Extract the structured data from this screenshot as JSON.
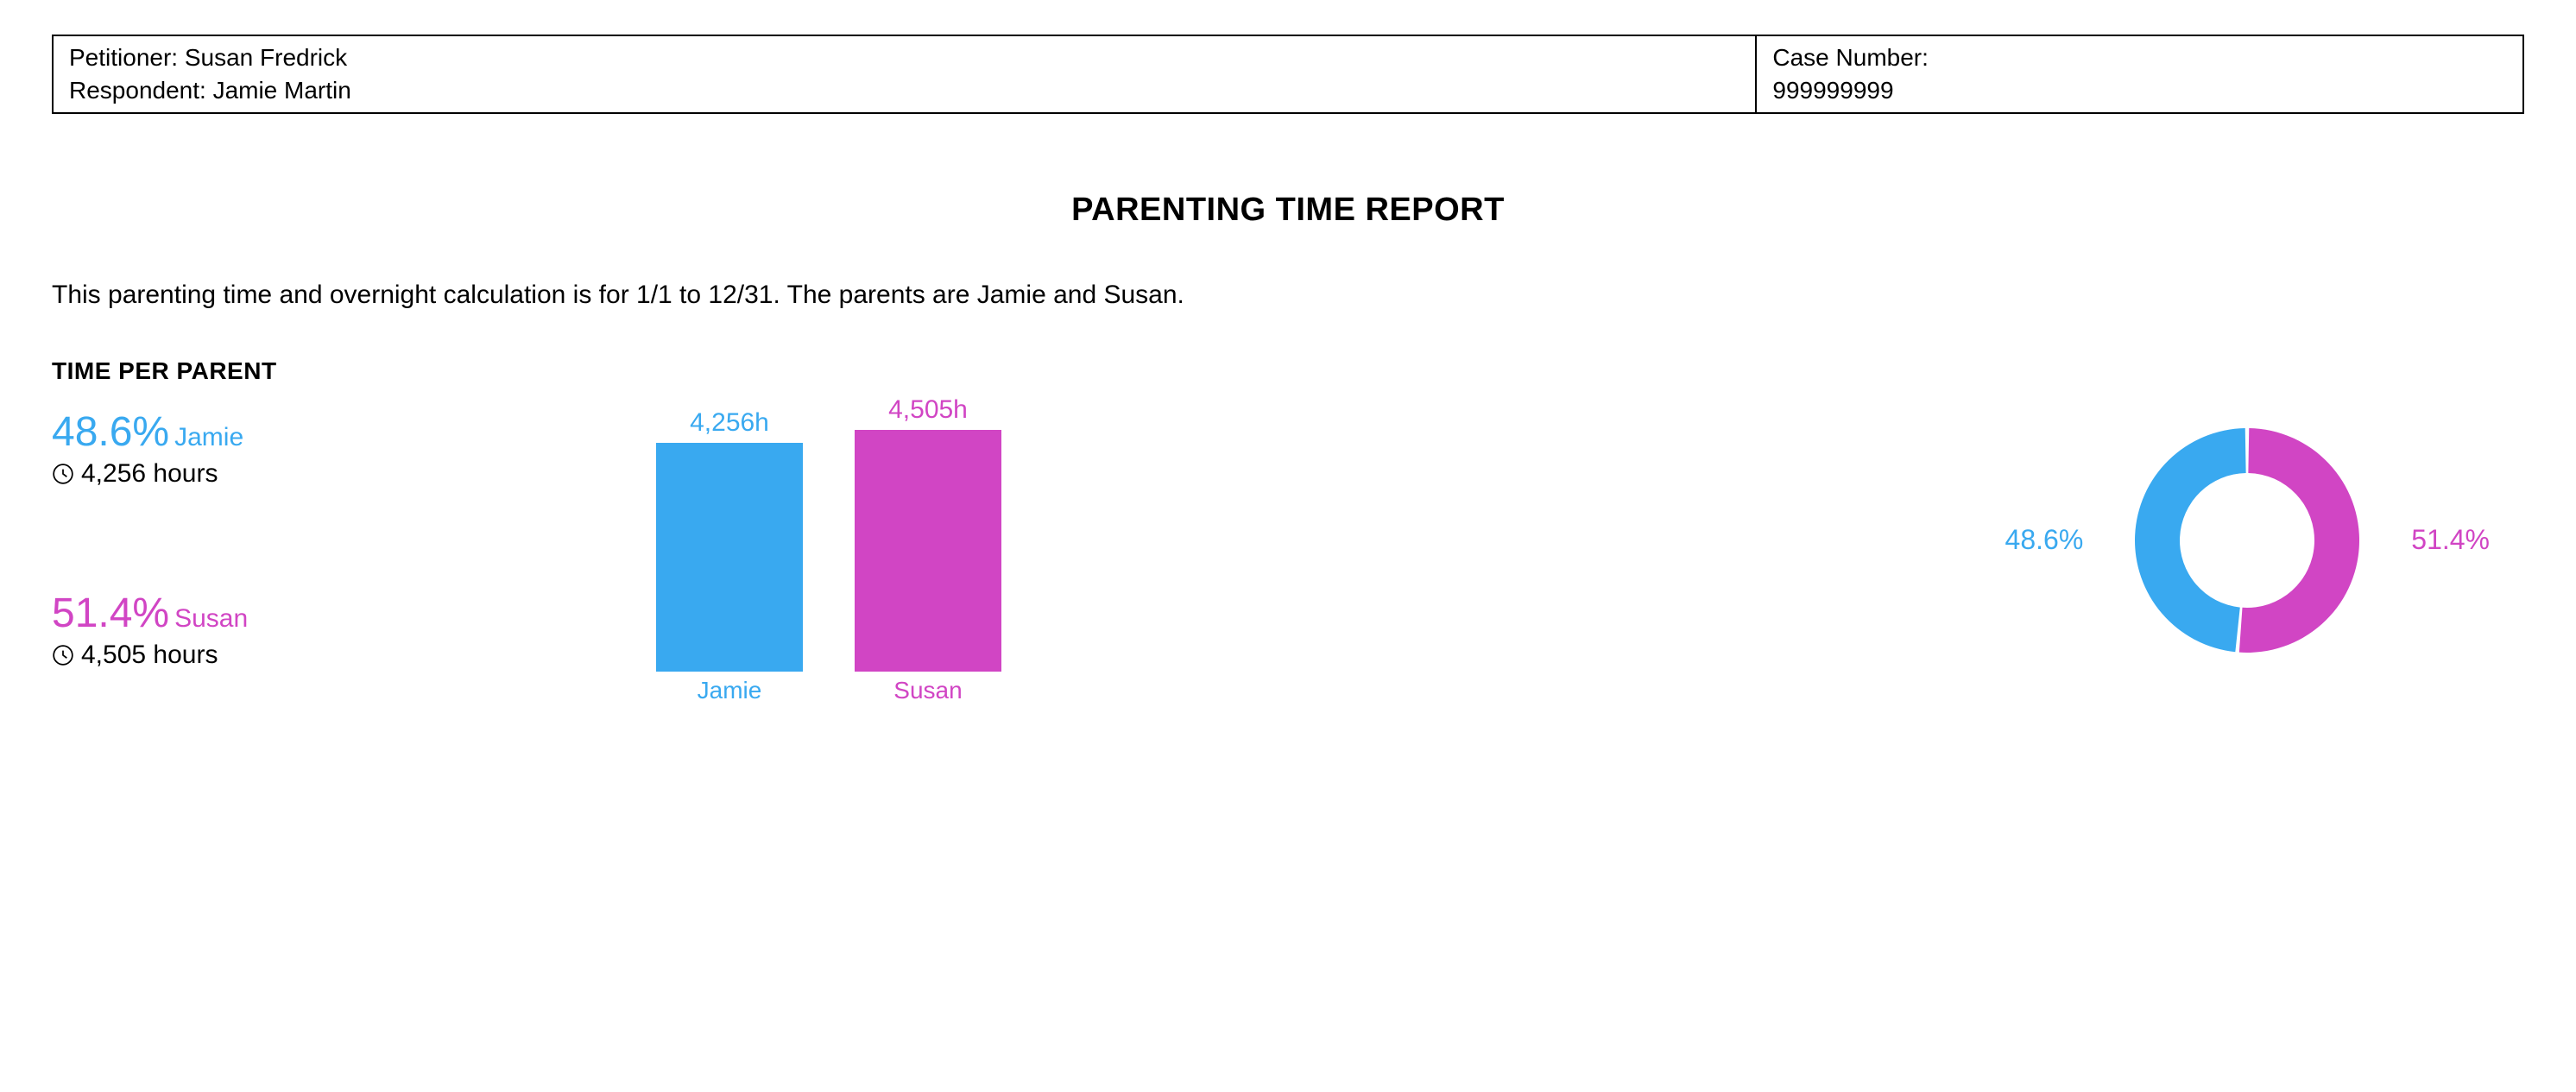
{
  "header": {
    "petitioner_label": "Petitioner: Susan Fredrick",
    "respondent_label": "Respondent: Jamie Martin",
    "case_number_label": "Case Number:",
    "case_number": "999999999"
  },
  "title": "PARENTING TIME REPORT",
  "intro": "This parenting time and overnight calculation is for 1/1 to 12/31. The parents are Jamie and Susan.",
  "section_heading": "TIME PER PARENT",
  "colors": {
    "jamie": "#39a9f0",
    "susan": "#d145c4"
  },
  "stats": {
    "jamie": {
      "pct": "48.6%",
      "name": "Jamie",
      "hours": "4,256 hours"
    },
    "susan": {
      "pct": "51.4%",
      "name": "Susan",
      "hours": "4,505 hours"
    }
  },
  "donut_labels": {
    "left_pct": "48.6%",
    "right_pct": "51.4%"
  },
  "chart_data": [
    {
      "type": "bar",
      "title": "",
      "categories": [
        "Jamie",
        "Susan"
      ],
      "series": [
        {
          "name": "Hours",
          "values": [
            4256,
            4505
          ]
        }
      ],
      "value_labels": [
        "4,256h",
        "4,505h"
      ],
      "colors": [
        "#39a9f0",
        "#d145c4"
      ],
      "ylim": [
        0,
        4505
      ]
    },
    {
      "type": "pie",
      "subtype": "donut",
      "title": "",
      "categories": [
        "Jamie",
        "Susan"
      ],
      "values": [
        48.6,
        51.4
      ],
      "value_labels": [
        "48.6%",
        "51.4%"
      ],
      "colors": [
        "#39a9f0",
        "#d145c4"
      ]
    }
  ]
}
